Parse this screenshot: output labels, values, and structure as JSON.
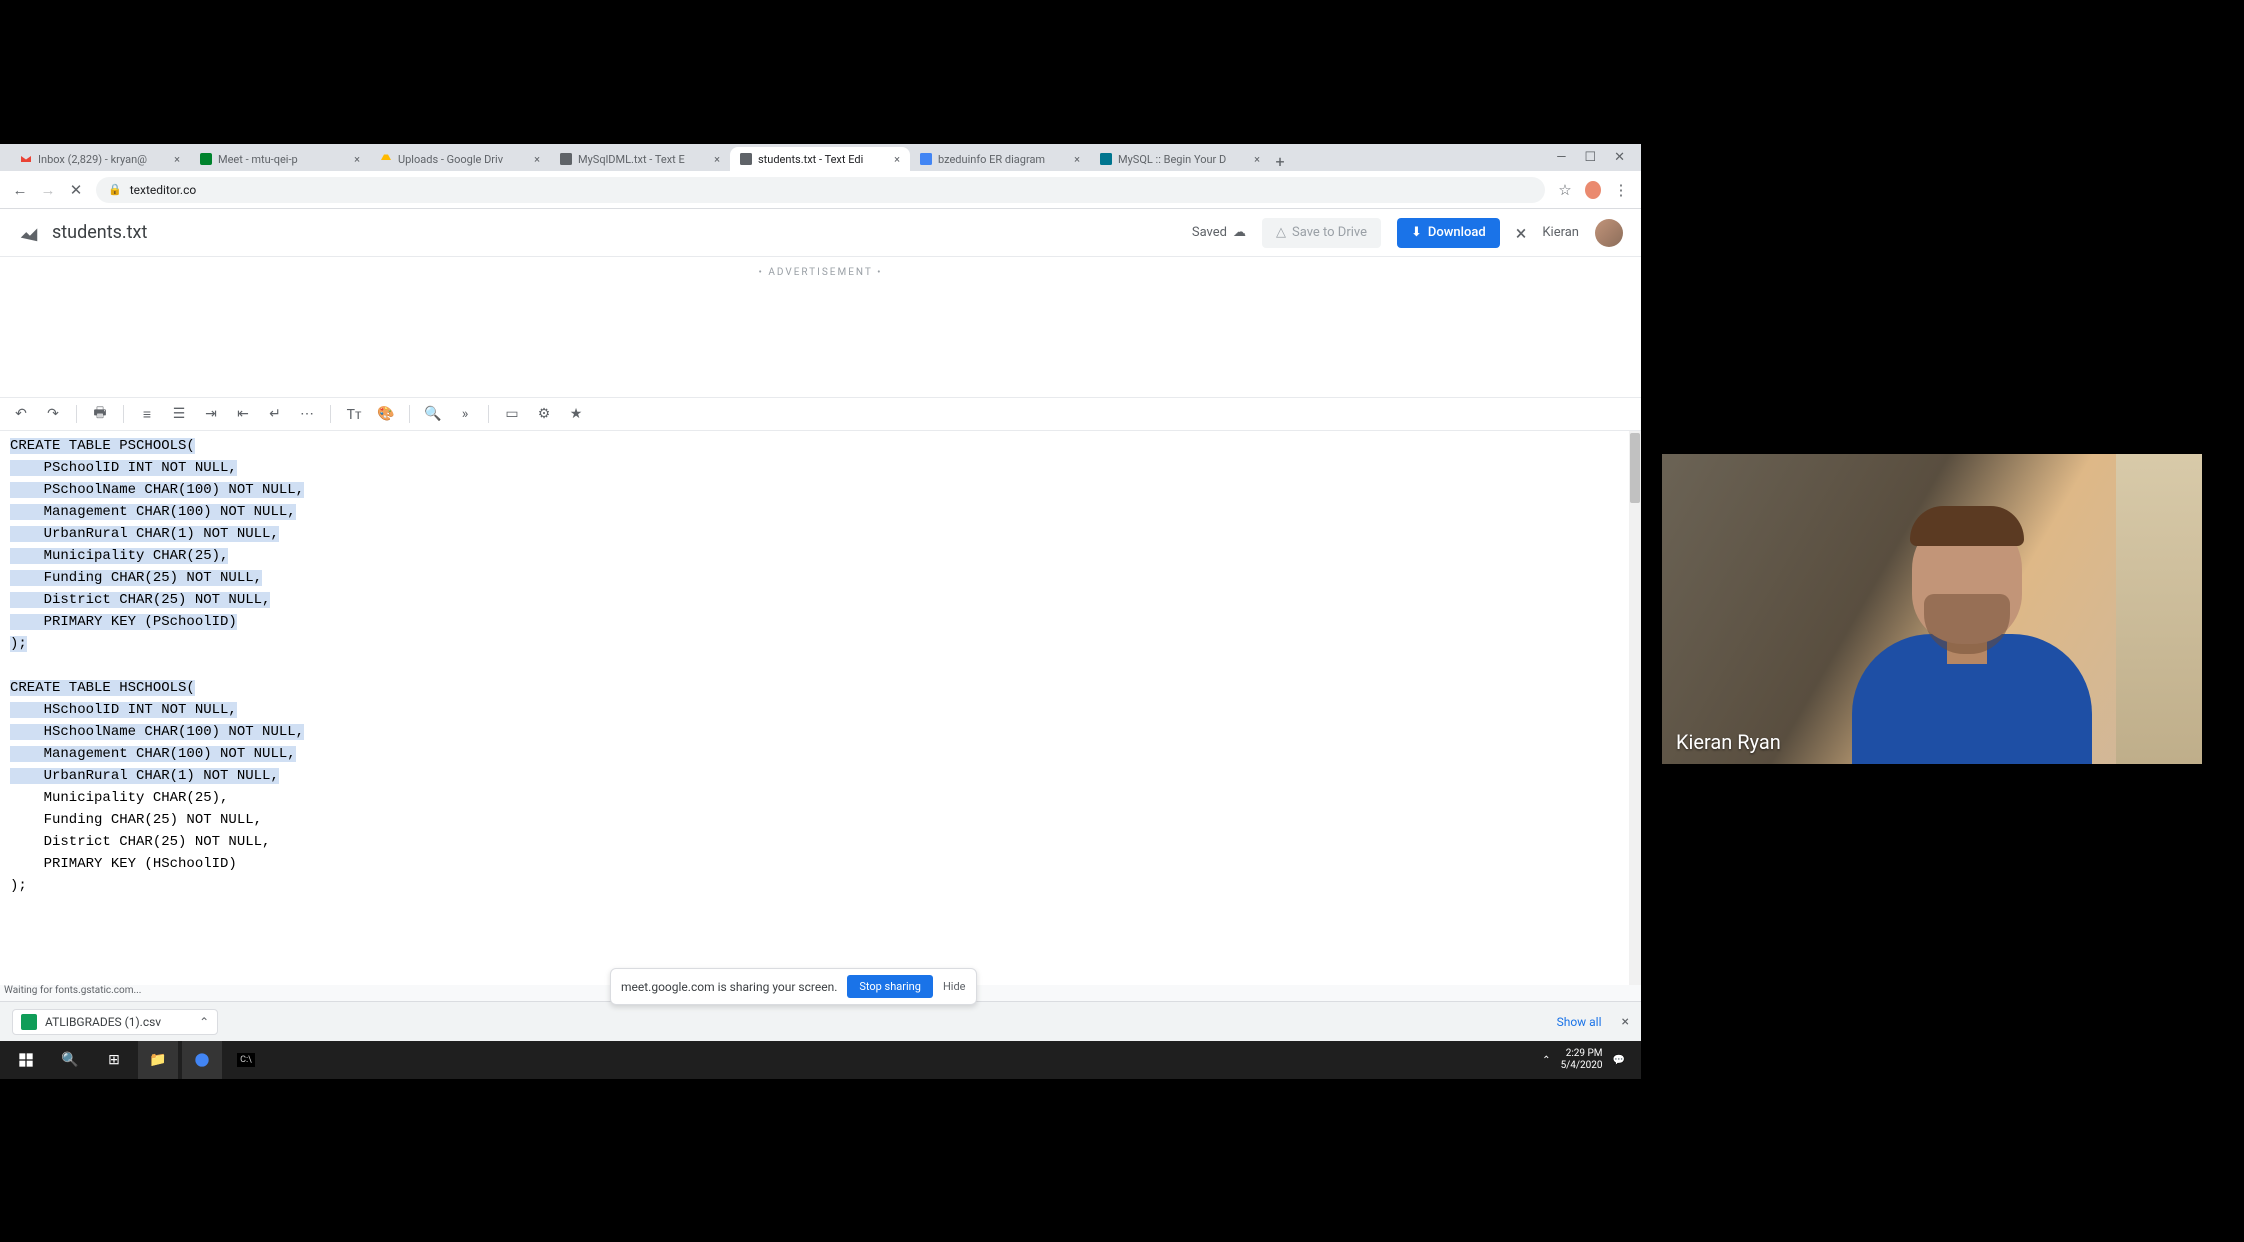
{
  "tabs": [
    {
      "label": "Inbox (2,829) - kryan@",
      "favicon": "gmail"
    },
    {
      "label": "Meet - mtu-qei-p",
      "favicon": "meet"
    },
    {
      "label": "Uploads - Google Driv",
      "favicon": "drive"
    },
    {
      "label": "MySqlDML.txt - Text E",
      "favicon": "texteditor"
    },
    {
      "label": "students.txt - Text Edi",
      "favicon": "texteditor",
      "active": true
    },
    {
      "label": "bzeduinfo ER diagram",
      "favicon": "docs"
    },
    {
      "label": "MySQL :: Begin Your D",
      "favicon": "mysql"
    }
  ],
  "address": {
    "url": "texteditor.co"
  },
  "header": {
    "doc_title": "students.txt",
    "saved_label": "Saved",
    "save_drive": "Save to Drive",
    "download": "Download",
    "user": "Kieran"
  },
  "ad_label": "• ADVERTISEMENT •",
  "status_text": "Waiting for fonts.gstatic.com...",
  "download_bar": {
    "item": "ATLIBGRADES (1).csv",
    "showall": "Show all"
  },
  "share_bubble": {
    "text": "meet.google.com is sharing your screen.",
    "stop": "Stop sharing",
    "hide": "Hide"
  },
  "clock": {
    "time": "2:29 PM",
    "date": "5/4/2020"
  },
  "webcam": {
    "name": "Kieran Ryan"
  },
  "code": {
    "highlighted": "CREATE TABLE PSCHOOLS(\n    PSchoolID INT NOT NULL,\n    PSchoolName CHAR(100) NOT NULL,\n    Management CHAR(100) NOT NULL,\n    UrbanRural CHAR(1) NOT NULL,\n    Municipality CHAR(25),\n    Funding CHAR(25) NOT NULL,\n    District CHAR(25) NOT NULL,\n    PRIMARY KEY (PSchoolID)\n);\n\nCREATE TABLE HSCHOOLS(\n    HSchoolID INT NOT NULL,\n    HSchoolName CHAR(100) NOT NULL,\n    Management CHAR(100) NOT NULL,\n    UrbanRural CH",
    "cursor_fragment": "AR(1) NOT NULL,",
    "rest": "\n    Municipality CHAR(25),\n    Funding CHAR(25) NOT NULL,\n    District CHAR(25) NOT NULL,\n    PRIMARY KEY (HSchoolID)\n);"
  }
}
